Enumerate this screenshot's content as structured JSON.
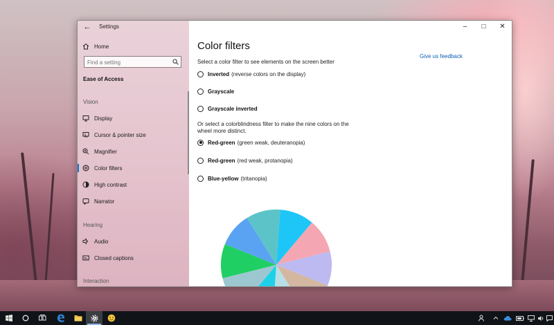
{
  "window": {
    "title": "Settings",
    "back_icon": "back-arrow-icon",
    "controls": [
      "minimize",
      "maximize",
      "close"
    ]
  },
  "sidebar": {
    "home_label": "Home",
    "search_placeholder": "Find a setting",
    "section_title": "Ease of Access",
    "groups": {
      "vision": "Vision",
      "hearing": "Hearing",
      "interaction": "Interaction"
    },
    "items": [
      {
        "label": "Display",
        "icon": "display-icon"
      },
      {
        "label": "Cursor & pointer size",
        "icon": "cursor-icon"
      },
      {
        "label": "Magnifier",
        "icon": "magnifier-icon"
      },
      {
        "label": "Color filters",
        "icon": "color-filter-icon",
        "selected": true
      },
      {
        "label": "High contrast",
        "icon": "high-contrast-icon"
      },
      {
        "label": "Narrator",
        "icon": "narrator-icon"
      },
      {
        "label": "Audio",
        "icon": "speaker-icon"
      },
      {
        "label": "Closed captions",
        "icon": "captions-icon"
      }
    ],
    "accent_color": "#1c6fbf"
  },
  "content": {
    "title": "Color filters",
    "feedback_link": "Give us feedback",
    "desc1": "Select a color filter to see elements on the screen better",
    "desc2": "Or select a colorblindness filter to make the nine colors on the wheel more distinct.",
    "filters": [
      {
        "bold": "Inverted",
        "note": "(reverse colors on the display)",
        "selected": false
      },
      {
        "bold": "Grayscale",
        "note": "",
        "selected": false
      },
      {
        "bold": "Grayscale inverted",
        "note": "",
        "selected": false
      }
    ],
    "colorblind_filters": [
      {
        "bold": "Red-green",
        "note": "(green weak, deuteranopia)",
        "selected": true
      },
      {
        "bold": "Red-green",
        "note": "(red weak, protanopia)",
        "selected": false
      },
      {
        "bold": "Blue-yellow",
        "note": "(tritanopia)",
        "selected": false
      }
    ],
    "wheel_colors": [
      "#f4a7b3",
      "#bcbaf0",
      "#d3b7a0",
      "#b8dfe6",
      "#1ed1e8",
      "#9dc7d0",
      "#1fcf64",
      "#5aa3f2",
      "#5cc4c8",
      "#1ec6f7"
    ]
  },
  "taskbar": {
    "icons": [
      "start-icon",
      "cortana-icon",
      "task-view-icon",
      "edge-icon",
      "file-explorer-icon",
      "settings-icon",
      "emoji-app-icon"
    ],
    "active": "settings-icon",
    "tray_icons": [
      "people-icon",
      "chevron-up-icon",
      "onedrive-icon",
      "battery-icon",
      "network-icon",
      "volume-icon",
      "action-center-icon"
    ]
  }
}
